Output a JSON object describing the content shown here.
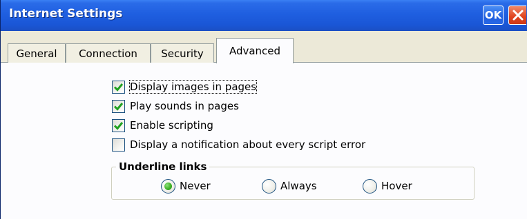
{
  "window": {
    "title": "Internet Settings",
    "ok_label": "OK"
  },
  "tabs": [
    {
      "label": "General"
    },
    {
      "label": "Connection"
    },
    {
      "label": "Security"
    },
    {
      "label": "Advanced",
      "selected": true
    }
  ],
  "checkboxes": [
    {
      "label": "Display images in pages",
      "checked": true
    },
    {
      "label": "Play sounds in pages",
      "checked": true
    },
    {
      "label": "Enable scripting",
      "checked": true
    },
    {
      "label": "Display a notification about every script error",
      "checked": false
    }
  ],
  "underline_links": {
    "title": "Underline links",
    "options": [
      {
        "label": "Never",
        "selected": true
      },
      {
        "label": "Always",
        "selected": false
      },
      {
        "label": "Hover",
        "selected": false
      }
    ]
  },
  "colors": {
    "titlebar": "#1f5fe0",
    "close_button": "#e0431e",
    "check_mark": "#21a121",
    "radio_dot": "#3fb327"
  }
}
